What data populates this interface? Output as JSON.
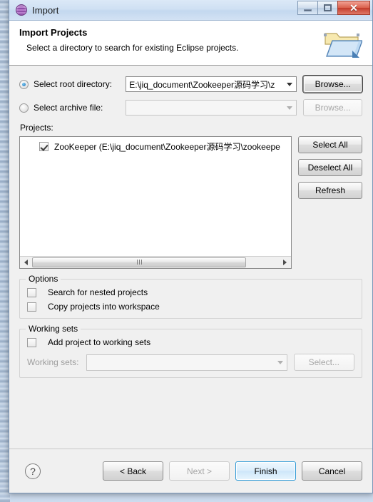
{
  "window": {
    "title": "Import",
    "icon": "eclipse-icon",
    "buttons": {
      "minimize": "minimize-button",
      "maximize": "maximize-button",
      "close_glyph": "✕"
    }
  },
  "banner": {
    "title": "Import Projects",
    "subtitle": "Select a directory to search for existing Eclipse projects.",
    "icon": "open-folder-icon"
  },
  "source": {
    "root_directory": {
      "label": "Select root directory:",
      "selected": true,
      "value": "E:\\jiq_document\\Zookeeper源码学习\\z",
      "browse_label": "Browse..."
    },
    "archive_file": {
      "label": "Select archive file:",
      "selected": false,
      "value": "",
      "browse_label": "Browse..."
    }
  },
  "projects": {
    "label": "Projects:",
    "items": [
      {
        "checked": true,
        "text": "ZooKeeper (E:\\jiq_document\\Zookeeper源码学习\\zookeepe"
      }
    ],
    "buttons": {
      "select_all": "Select All",
      "deselect_all": "Deselect All",
      "refresh": "Refresh"
    }
  },
  "options": {
    "legend": "Options",
    "items": [
      {
        "label": "Search for nested projects",
        "checked": false
      },
      {
        "label": "Copy projects into workspace",
        "checked": false
      }
    ]
  },
  "working_sets": {
    "legend": "Working sets",
    "add_checkbox": {
      "label": "Add project to working sets",
      "checked": false
    },
    "combo_label": "Working sets:",
    "combo_value": "",
    "select_label": "Select...",
    "enabled": false
  },
  "footer": {
    "help": "?",
    "back": "< Back",
    "next": "Next >",
    "finish": "Finish",
    "cancel": "Cancel",
    "next_enabled": false,
    "default_button": "Finish"
  },
  "colors": {
    "accent": "#2f9ad6",
    "close_button": "#c33c2b",
    "dialog_bg": "#f0f0f0",
    "banner_bg": "#ffffff"
  }
}
